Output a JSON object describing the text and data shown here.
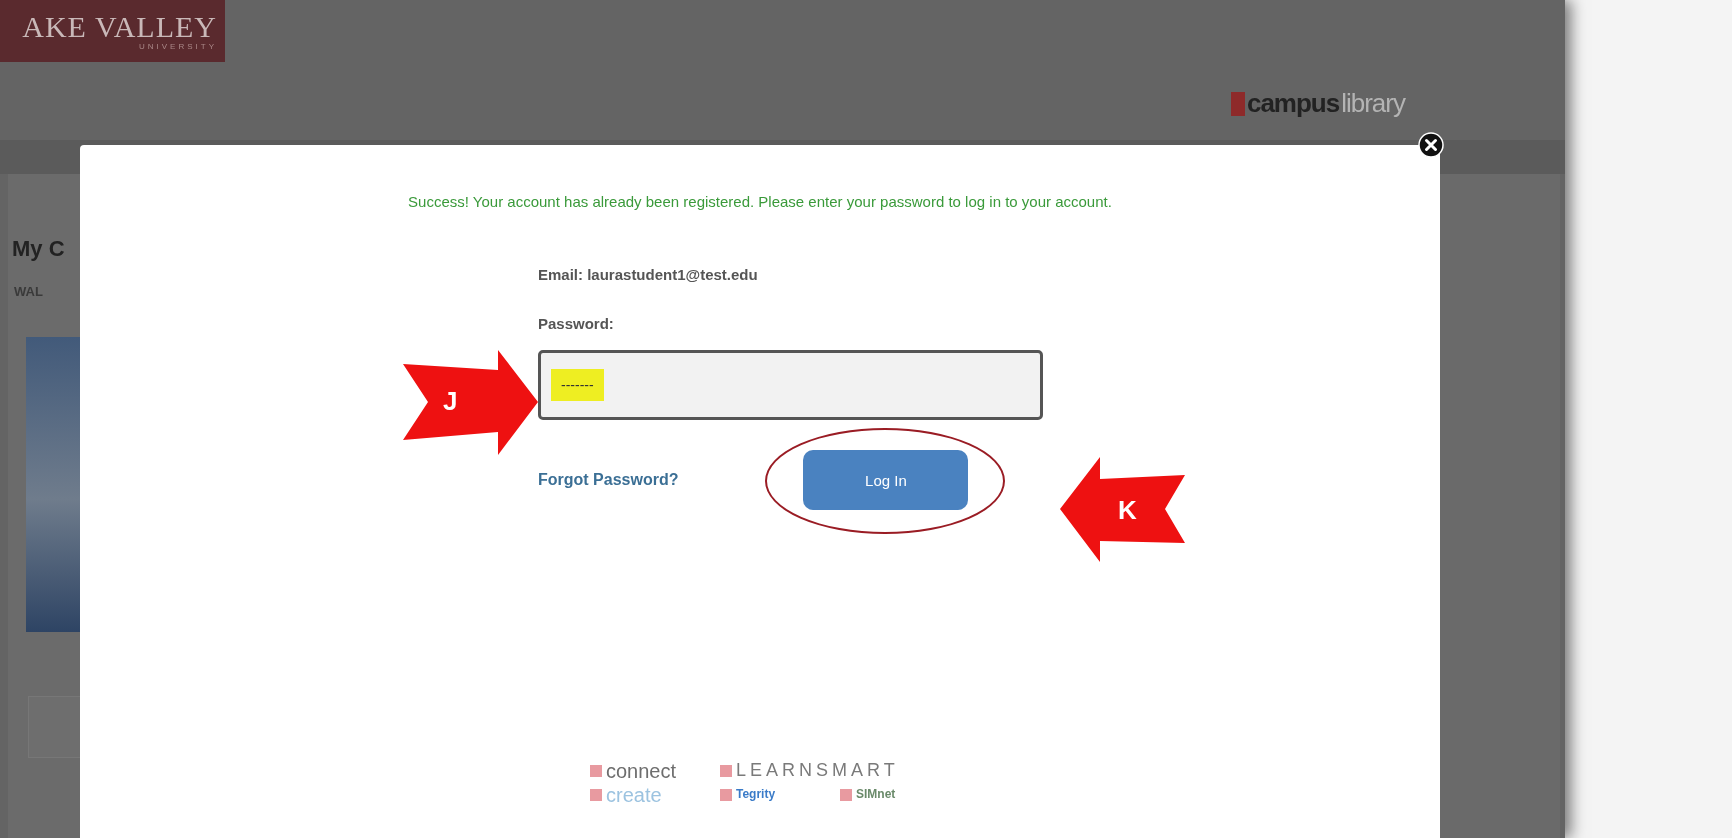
{
  "background": {
    "logo": {
      "name": "AKE VALLEY",
      "subtitle": "UNIVERSITY"
    },
    "brand": {
      "part_1": "campus",
      "part_2": "library"
    },
    "heading": "My C",
    "tab": "WAL"
  },
  "dialog": {
    "message": "Success! Your account has already been registered. Please enter your password to log in to your account.",
    "email_label": "Email: laurastudent1@test.edu",
    "password_label": "Password:",
    "password": {
      "value": "-------",
      "highlighted": true
    },
    "forgot_link": "Forgot Password?",
    "login_button": "Log In"
  },
  "product_rows": [
    {
      "items": [
        {
          "name": "connect",
          "color": "#6e6e6e"
        },
        {
          "name": "LEARNSMART",
          "color": "#7a7a7a"
        }
      ]
    },
    {
      "items": [
        {
          "name": "create",
          "color": "#9cc3e0"
        },
        {
          "name": "Tegrity",
          "color": "#3a7bc8"
        },
        {
          "name": "SIMnet",
          "color": "#6a8a6a"
        }
      ]
    }
  ],
  "annotations": [
    {
      "label": "J",
      "kind": "right_arrow"
    },
    {
      "label": "K",
      "kind": "left_arrow"
    }
  ]
}
